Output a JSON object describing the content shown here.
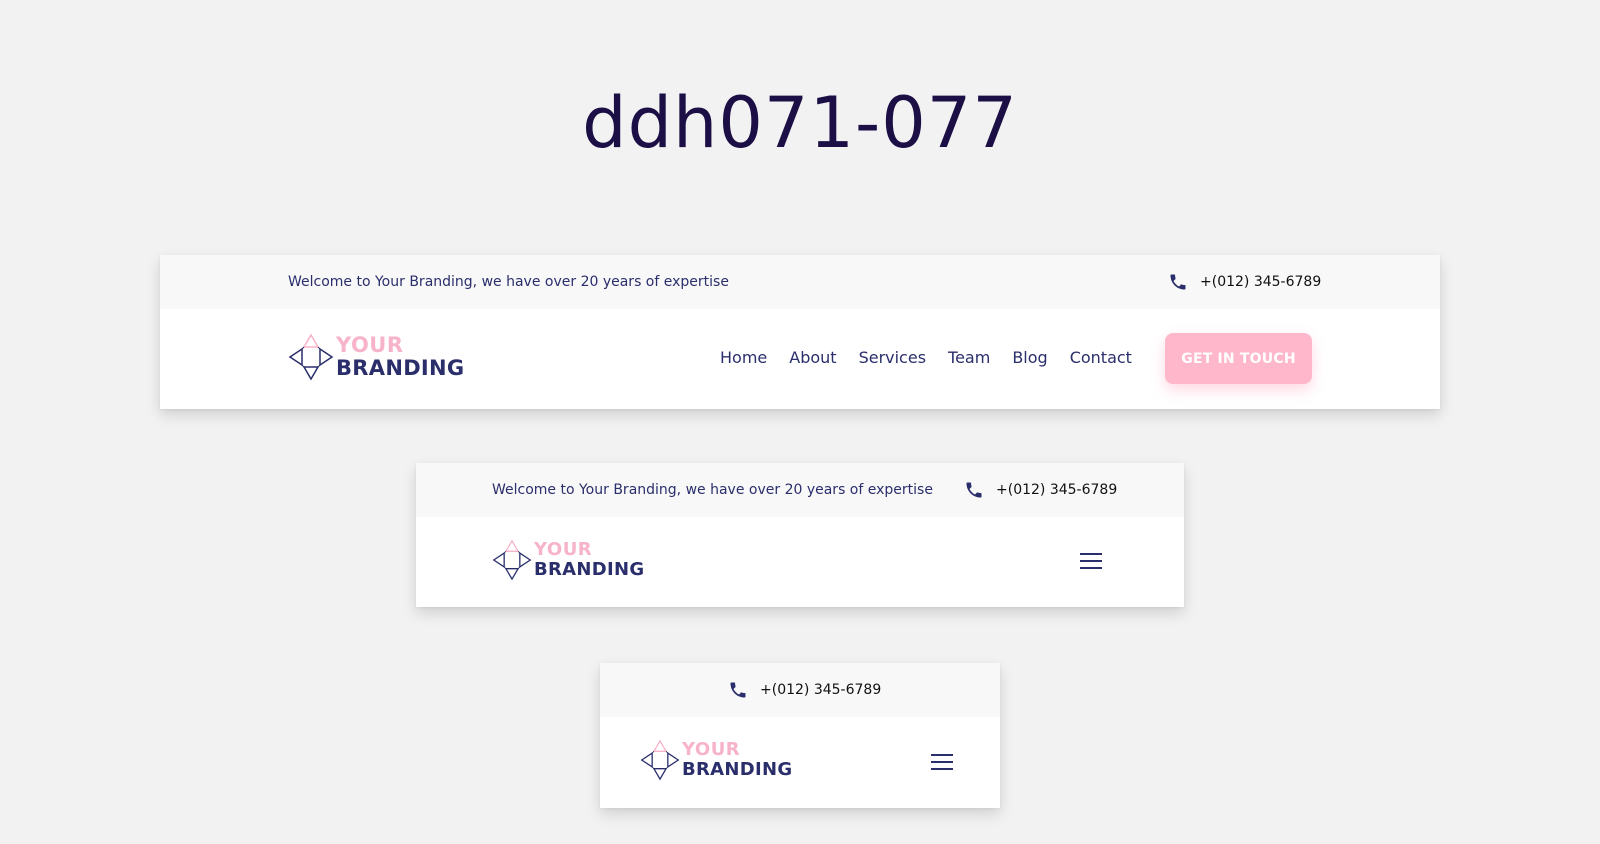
{
  "page": {
    "title": "ddh071-077"
  },
  "brand": {
    "line1": "YOUR",
    "line2": "BRANDING"
  },
  "colors": {
    "navy": "#2a2e6b",
    "pink": "#ffb8cb",
    "title": "#1b0f45",
    "topbar": "#f8f8f8"
  },
  "icons": {
    "phone": "phone-icon",
    "menu": "hamburger-menu-icon",
    "logo": "logo-diamond-icon"
  },
  "desktop": {
    "welcome": "Welcome to Your Branding, we have over 20 years of expertise",
    "phone": "+(012) 345-6789",
    "nav": [
      "Home",
      "About",
      "Services",
      "Team",
      "Blog",
      "Contact"
    ],
    "cta": "GET IN TOUCH"
  },
  "tablet": {
    "welcome": "Welcome to Your Branding, we have over 20 years of expertise",
    "phone": "+(012) 345-6789"
  },
  "mobile": {
    "phone": "+(012) 345-6789"
  }
}
